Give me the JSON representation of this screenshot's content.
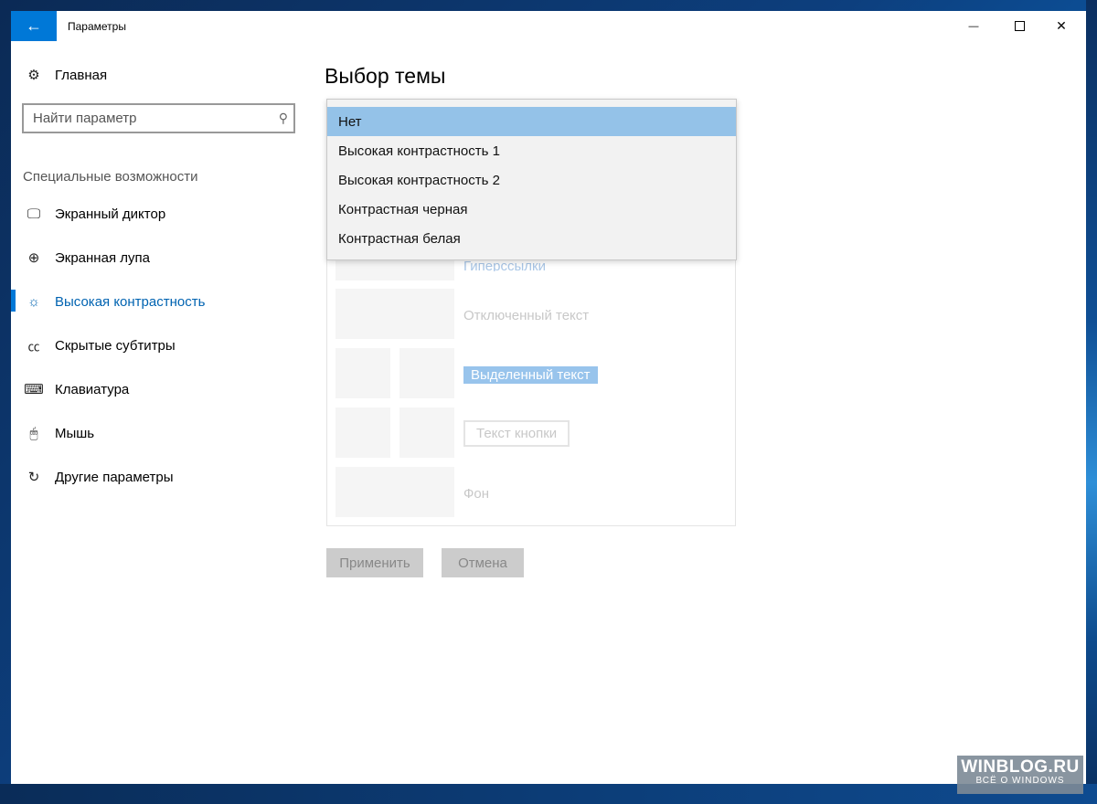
{
  "window": {
    "title": "Параметры",
    "back_icon": "←",
    "minimize_icon": "—",
    "close_icon": "✕"
  },
  "sidebar": {
    "home": {
      "label": "Главная",
      "icon": "⚙"
    },
    "search": {
      "placeholder": "Найти параметр",
      "icon": "⚲"
    },
    "section_title": "Специальные возможности",
    "items": [
      {
        "label": "Экранный диктор",
        "icon": "🖵"
      },
      {
        "label": "Экранная лупа",
        "icon": "⊕"
      },
      {
        "label": "Высокая контрастность",
        "icon": "☼"
      },
      {
        "label": "Скрытые субтитры",
        "icon": "㏄"
      },
      {
        "label": "Клавиатура",
        "icon": "⌨"
      },
      {
        "label": "Мышь",
        "icon": "🖱"
      },
      {
        "label": "Другие параметры",
        "icon": "↻"
      }
    ],
    "active_index": 2
  },
  "main": {
    "title": "Выбор темы",
    "theme_dropdown": {
      "selected": "Нет",
      "options": [
        "Нет",
        "Высокая контрастность 1",
        "Высокая контрастность 2",
        "Контрастная черная",
        "Контрастная белая"
      ]
    },
    "preview": {
      "hyperlink_partial": "Гиперссылки",
      "disabled_text": "Отключенный текст",
      "selected_text": "Выделенный текст",
      "button_text": "Текст кнопки",
      "background": "Фон"
    },
    "apply_button": "Применить",
    "cancel_button": "Отмена"
  },
  "watermark": {
    "main": "WINBLOG.RU",
    "sub": "ВСЁ О WINDOWS"
  },
  "colors": {
    "accent": "#0078d7",
    "selected_option": "#94c2e8"
  }
}
